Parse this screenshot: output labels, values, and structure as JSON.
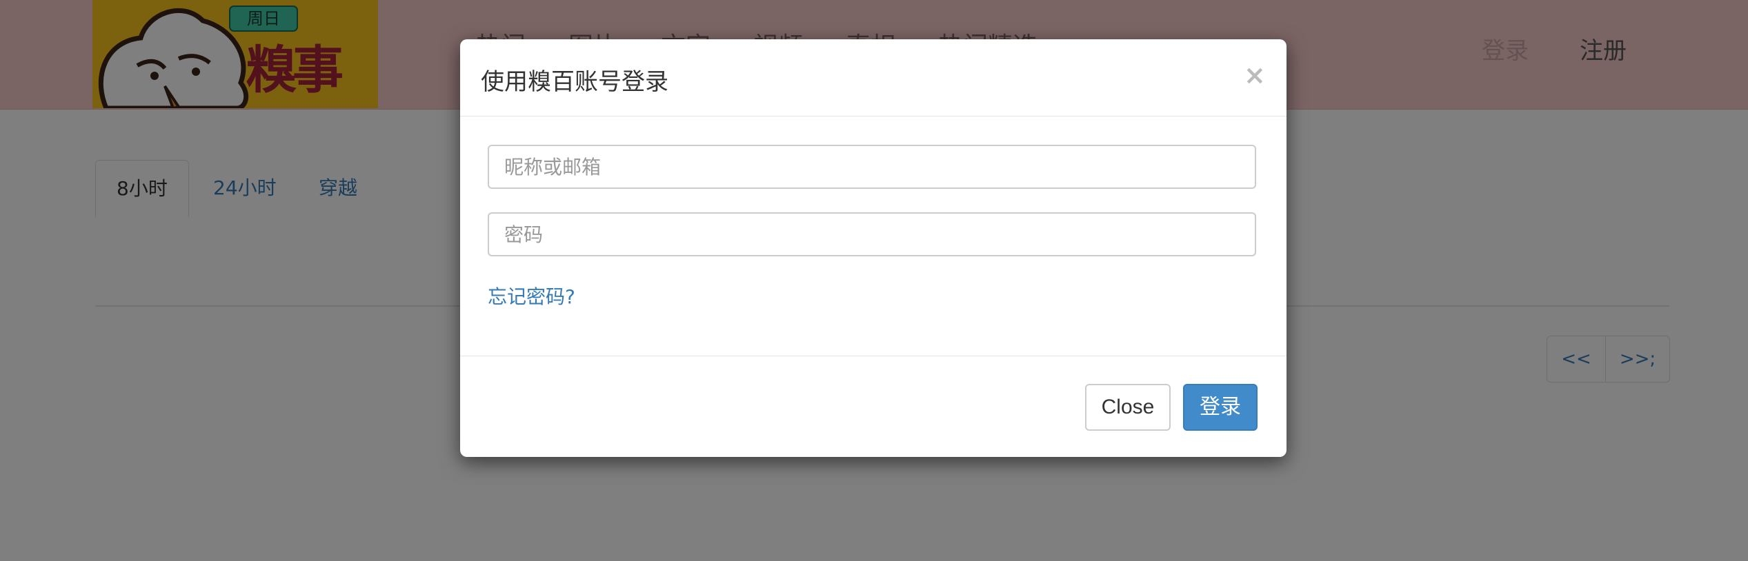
{
  "navbar": {
    "logo_badge": "周日",
    "logo_text": "糗事百科",
    "links": [
      "热门",
      "图片",
      "文字",
      "视频",
      "真相",
      "热门精选"
    ],
    "login": "登录",
    "register": "注册"
  },
  "tabs": [
    {
      "label": "8小时",
      "active": true
    },
    {
      "label": "24小时",
      "active": false
    },
    {
      "label": "穿越",
      "active": false
    }
  ],
  "pager": {
    "prev": "<<",
    "next": ">>;"
  },
  "modal": {
    "title": "使用糗百账号登录",
    "close_icon": "×",
    "username_placeholder": "昵称或邮箱",
    "username_value": "",
    "password_placeholder": "密码",
    "password_value": "",
    "forgot_link": "忘记密码?",
    "close_button": "Close",
    "login_button": "登录"
  },
  "colors": {
    "navbar_bg": "#f7c9c9",
    "logo_bg": "#f8c31c",
    "link": "#337ab7",
    "primary_button": "#428bca",
    "backdrop": "rgba(0,0,0,0.5)"
  }
}
